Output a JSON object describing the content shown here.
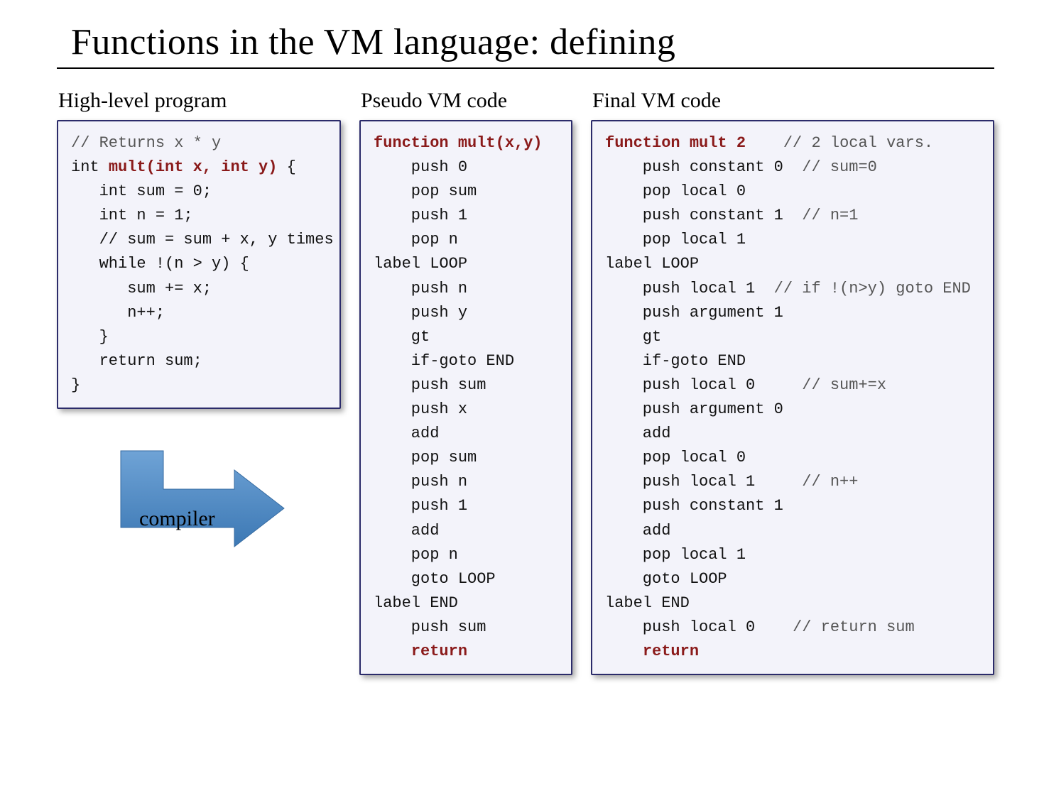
{
  "title": "Functions in the VM language: defining",
  "arrow_label": "compiler",
  "columns": {
    "high": {
      "heading": "High-level program",
      "lines": [
        {
          "t": "// Returns x * y",
          "cls": "cm"
        },
        {
          "prefix": "int ",
          "kw": "mult(int x, int y)",
          "suffix": " {"
        },
        {
          "t": "   int sum = 0;"
        },
        {
          "t": "   int n = 1;"
        },
        {
          "t": "   // sum = sum + x, y times"
        },
        {
          "t": "   while !(n > y) {"
        },
        {
          "t": "      sum += x;"
        },
        {
          "t": "      n++;"
        },
        {
          "t": "   }"
        },
        {
          "t": "   return sum;"
        },
        {
          "t": "}"
        }
      ]
    },
    "pseudo": {
      "heading": "Pseudo VM code",
      "lines": [
        {
          "kw": "function mult(x,y)"
        },
        {
          "t": "    push 0"
        },
        {
          "t": "    pop sum"
        },
        {
          "t": "    push 1"
        },
        {
          "t": "    pop n"
        },
        {
          "t": "label LOOP"
        },
        {
          "t": "    push n"
        },
        {
          "t": "    push y"
        },
        {
          "t": "    gt"
        },
        {
          "t": "    if-goto END"
        },
        {
          "t": "    push sum"
        },
        {
          "t": "    push x"
        },
        {
          "t": "    add"
        },
        {
          "t": "    pop sum"
        },
        {
          "t": "    push n"
        },
        {
          "t": "    push 1"
        },
        {
          "t": "    add"
        },
        {
          "t": "    pop n"
        },
        {
          "t": "    goto LOOP"
        },
        {
          "t": "label END"
        },
        {
          "t": "    push sum"
        },
        {
          "t": "    ",
          "kw": "return"
        }
      ]
    },
    "final": {
      "heading": "Final VM code",
      "lines": [
        {
          "kw": "function mult 2",
          "pad": "    ",
          "cm": "// 2 local vars."
        },
        {
          "t": "    push constant 0  ",
          "cm": "// sum=0"
        },
        {
          "t": "    pop local 0"
        },
        {
          "t": "    push constant 1  ",
          "cm": "// n=1"
        },
        {
          "t": "    pop local 1"
        },
        {
          "t": "label LOOP"
        },
        {
          "t": "    push local 1  ",
          "cm": "// if !(n>y) goto END"
        },
        {
          "t": "    push argument 1"
        },
        {
          "t": "    gt"
        },
        {
          "t": "    if-goto END"
        },
        {
          "t": "    push local 0     ",
          "cm": "// sum+=x"
        },
        {
          "t": "    push argument 0"
        },
        {
          "t": "    add"
        },
        {
          "t": "    pop local 0"
        },
        {
          "t": "    push local 1     ",
          "cm": "// n++"
        },
        {
          "t": "    push constant 1"
        },
        {
          "t": "    add"
        },
        {
          "t": "    pop local 1"
        },
        {
          "t": "    goto LOOP"
        },
        {
          "t": "label END"
        },
        {
          "t": "    push local 0    ",
          "cm": "// return sum"
        },
        {
          "t": "    ",
          "kw": "return"
        }
      ]
    }
  }
}
